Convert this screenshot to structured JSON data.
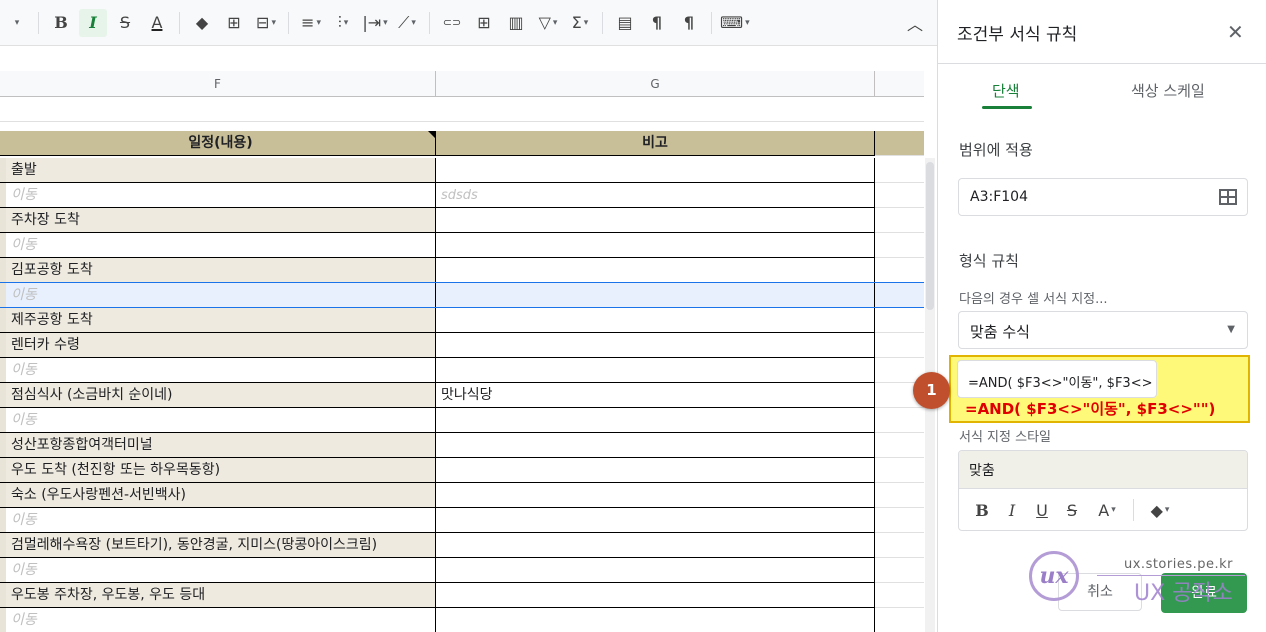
{
  "toolbar": {
    "buttons": [
      {
        "name": "caret-icon",
        "glyph": "▾"
      },
      {
        "name": "bold-icon",
        "glyph": "B"
      },
      {
        "name": "italic-icon",
        "glyph": "I"
      },
      {
        "name": "strikethrough-icon",
        "glyph": "S"
      },
      {
        "name": "text-color-icon",
        "glyph": "A"
      },
      {
        "name": "fill-color-icon",
        "glyph": "◆"
      },
      {
        "name": "borders-icon",
        "glyph": "⊞"
      },
      {
        "name": "merge-cells-icon",
        "glyph": "⊟"
      },
      {
        "name": "horizontal-align-icon",
        "glyph": "≡"
      },
      {
        "name": "vertical-align-icon",
        "glyph": "⫶"
      },
      {
        "name": "text-wrap-icon",
        "glyph": "|⇥"
      },
      {
        "name": "text-rotation-icon",
        "glyph": "⟋"
      },
      {
        "name": "insert-link-icon",
        "glyph": "⊂⊃"
      },
      {
        "name": "insert-comment-icon",
        "glyph": "⊞"
      },
      {
        "name": "insert-chart-icon",
        "glyph": "▥"
      },
      {
        "name": "filter-icon",
        "glyph": "▽"
      },
      {
        "name": "functions-icon",
        "glyph": "Σ"
      },
      {
        "name": "freeze-icon",
        "glyph": "▤"
      },
      {
        "name": "ltr-icon",
        "glyph": "¶"
      },
      {
        "name": "rtl-icon",
        "glyph": "¶"
      },
      {
        "name": "input-tools-icon",
        "glyph": "⌨"
      },
      {
        "name": "collapse-icon",
        "glyph": "︿"
      }
    ]
  },
  "sheet": {
    "columns": [
      "F",
      "G"
    ],
    "headers": {
      "f": "일정(내용)",
      "g": "비고"
    },
    "rows": [
      {
        "f": "출발",
        "g": "",
        "type": "shade"
      },
      {
        "f": "이동",
        "g": "sdsds",
        "type": "move"
      },
      {
        "f": "주차장 도착",
        "g": "",
        "type": "shade"
      },
      {
        "f": "이동",
        "g": "",
        "type": "move"
      },
      {
        "f": "김포공항 도착",
        "g": "",
        "type": "shade"
      },
      {
        "f": "이동",
        "g": "",
        "type": "move-selected"
      },
      {
        "f": "제주공항 도착",
        "g": "",
        "type": "shade"
      },
      {
        "f": "렌터카 수령",
        "g": "",
        "type": "shade"
      },
      {
        "f": "이동",
        "g": "",
        "type": "move"
      },
      {
        "f": "점심식사 (소금바치 순이네)",
        "g": "맛나식당",
        "type": "shade"
      },
      {
        "f": "이동",
        "g": "",
        "type": "move"
      },
      {
        "f": "성산포항종합여객터미널",
        "g": "",
        "type": "shade"
      },
      {
        "f": "우도 도착 (천진항 또는 하우목동항)",
        "g": "",
        "type": "shade"
      },
      {
        "f": "숙소 (우도사랑펜션-서빈백사)",
        "g": "",
        "type": "shade"
      },
      {
        "f": "이동",
        "g": "",
        "type": "move"
      },
      {
        "f": "검멀레해수욕장 (보트타기), 동안경굴, 지미스(땅콩아이스크림)",
        "g": "",
        "type": "shade"
      },
      {
        "f": "이동",
        "g": "",
        "type": "move"
      },
      {
        "f": "우도봉 주차장, 우도봉, 우도 등대",
        "g": "",
        "type": "shade"
      },
      {
        "f": "이동",
        "g": "",
        "type": "move"
      }
    ]
  },
  "panel": {
    "title": "조건부 서식 규칙",
    "tabs": {
      "single": "단색",
      "scale": "색상 스케일"
    },
    "range_label": "범위에 적용",
    "range_value": "A3:F104",
    "rules_label": "형식 규칙",
    "condition_label": "다음의 경우 셀 서식 지정...",
    "condition_value": "맞춤 수식",
    "formula_input": "=AND( $F3<>\"이동\", $F3<>\"\")",
    "formula_annotation": "=AND( $F3<>\"이동\", $F3<>\"\")",
    "step_badge": "1",
    "style_label": "서식 지정 스타일",
    "style_preview": "맞춤",
    "style_tools": {
      "bold": "B",
      "italic": "I",
      "underline": "U",
      "strike": "S",
      "text_color": "A",
      "fill": "◆"
    },
    "cancel": "취소",
    "done": "완료"
  },
  "watermark": {
    "url": "ux.stories.pe.kr",
    "text": "UX 공작소",
    "logo": "ux"
  },
  "colors": {
    "header_fill": "#c8bf98",
    "row_shade": "#eeeae0",
    "accent_green": "#188038",
    "highlight_yellow": "#fff97a",
    "formula_red": "#e00000",
    "badge": "#c0502d"
  }
}
